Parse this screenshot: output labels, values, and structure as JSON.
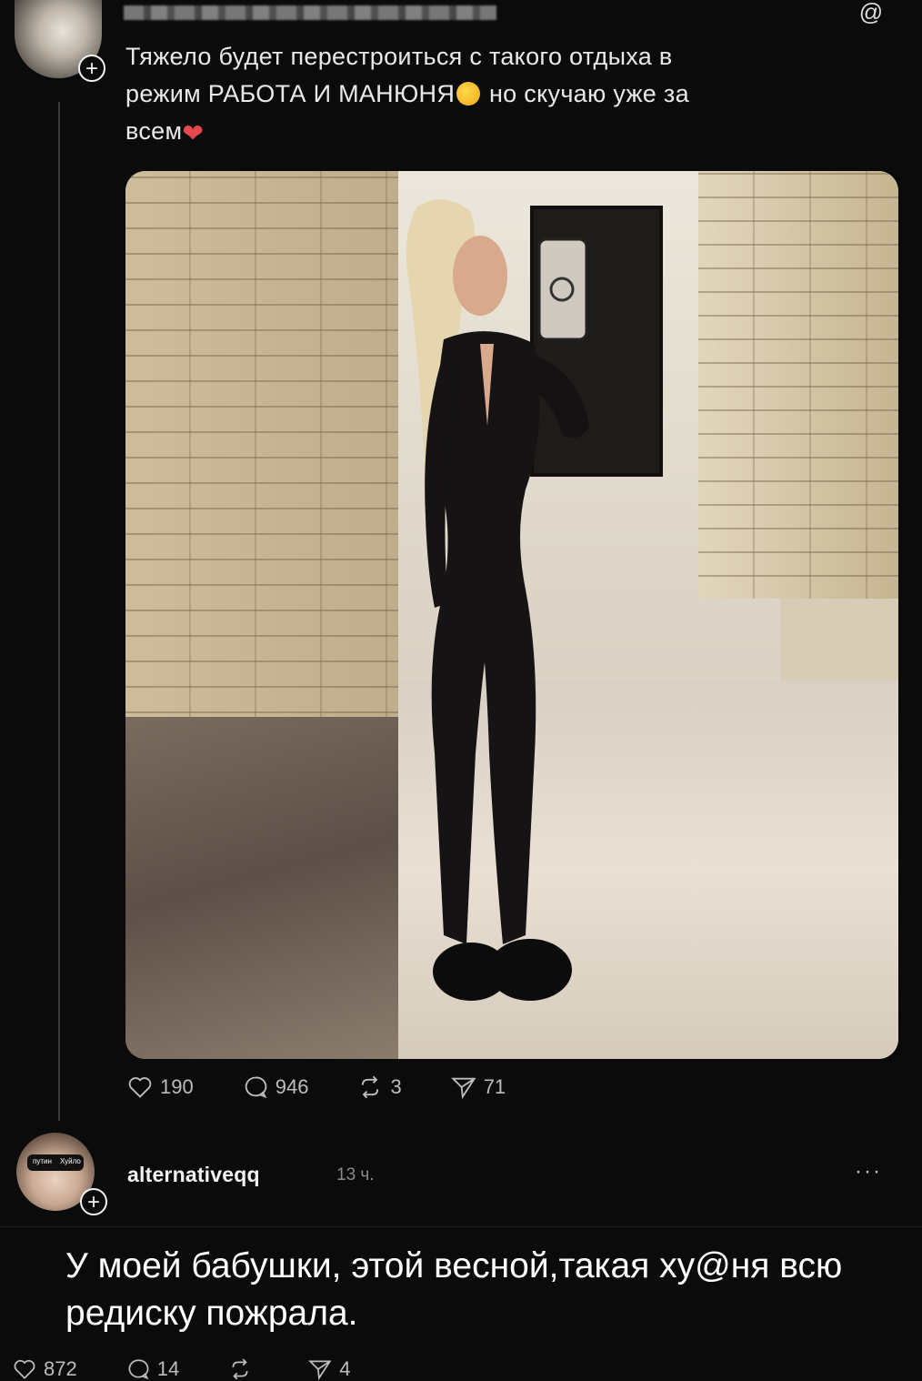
{
  "post": {
    "text_line1": "Тяжело будет перестроиться с такого отдыха в",
    "text_line2a": "режим РАБОТА И МАНЮНЯ",
    "text_line2b": "но скучаю уже за",
    "text_line3": "всем",
    "stats": {
      "likes": "190",
      "comments": "946",
      "reposts": "3",
      "shares": "71"
    }
  },
  "reply": {
    "username": "alternativeqq",
    "time": "13 ч.",
    "more": "···",
    "text": "У моей бабушки, этой весной,такая ху@ня всю редиску пожрала.",
    "stats": {
      "likes": "872",
      "comments": "14",
      "reposts": "",
      "shares": "4"
    },
    "avatar_glasses_left": "путин",
    "avatar_glasses_right": "Хуйло"
  },
  "colors": {
    "background": "#0b0b0b",
    "text": "#f2f2f2",
    "muted": "#8a8a8a"
  },
  "icons": [
    "plus-icon",
    "threads-logo-icon",
    "heart-icon",
    "comment-icon",
    "repost-icon",
    "share-icon",
    "more-icon"
  ]
}
